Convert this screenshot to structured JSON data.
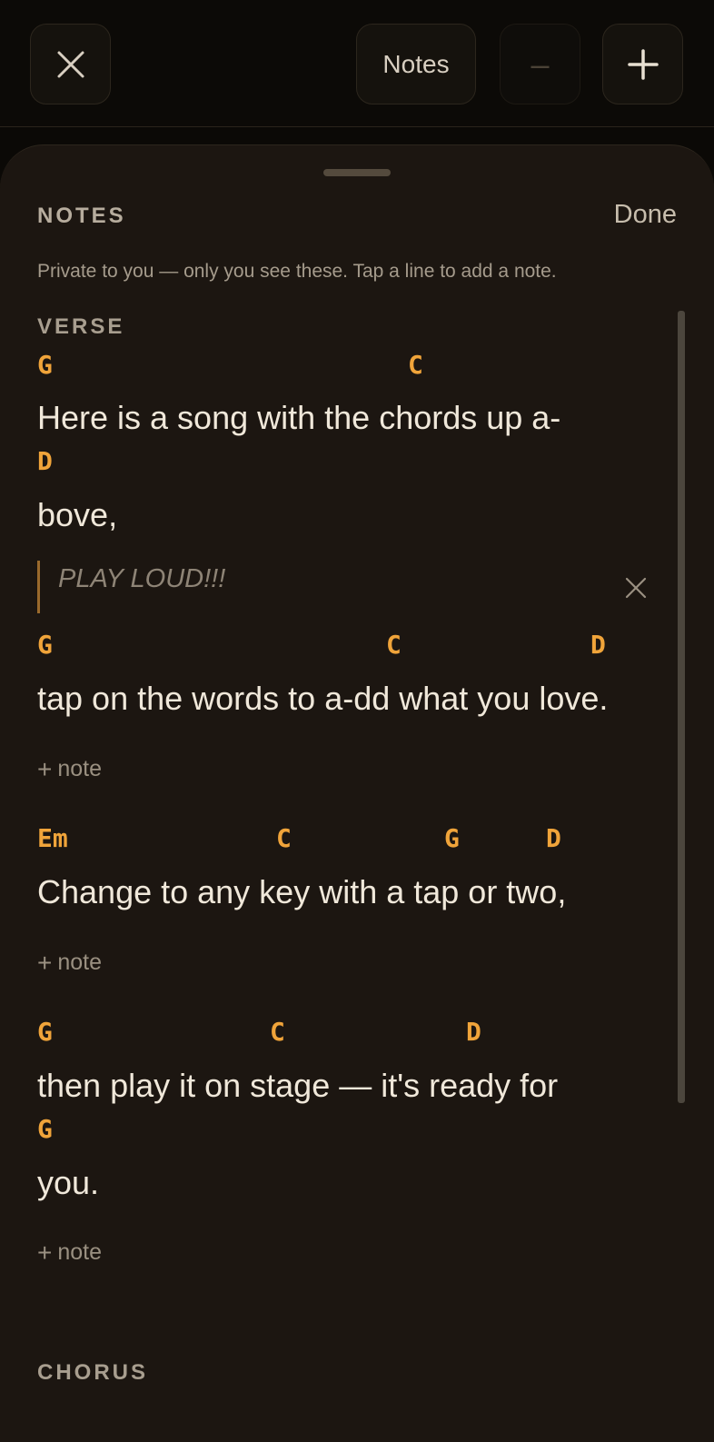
{
  "toolbar": {
    "close_icon": "close-icon",
    "notes_label": "Notes",
    "minus_label": "–",
    "plus_icon": "plus-icon"
  },
  "sheet": {
    "title": "NOTES",
    "done_label": "Done",
    "hint": "Private to you — only you see these. Tap a line to add a note."
  },
  "sections": [
    {
      "label": "VERSE",
      "lines": [
        {
          "chords": [
            "G",
            "C"
          ],
          "lyric": "Here is a song with the chords up a-"
        },
        {
          "chords": [
            "D"
          ],
          "lyric": "bove,"
        },
        {
          "chords": [
            "G",
            "C",
            "D"
          ],
          "lyric": "tap on the words to a-dd what you love."
        },
        {
          "chords": [
            "Em",
            "C",
            "G",
            "D"
          ],
          "lyric": "Change to any key with a tap or two,"
        },
        {
          "chords": [
            "G",
            "C",
            "D"
          ],
          "lyric": "then play it on stage — it's ready for"
        },
        {
          "chords": [
            "G"
          ],
          "lyric": "you."
        }
      ]
    },
    {
      "label": "CHORUS"
    }
  ],
  "note": {
    "text": "PLAY LOUD!!!"
  },
  "add_note_label": "note",
  "colors": {
    "chord": "#f0a43a",
    "background": "#1c1611",
    "note_bar": "#9a6a2c"
  }
}
